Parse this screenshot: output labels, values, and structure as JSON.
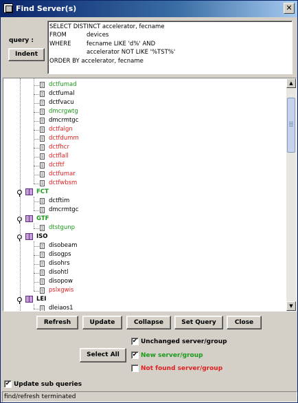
{
  "window": {
    "title": "Find Server(s)",
    "close_glyph": "✕"
  },
  "query": {
    "label": "query :",
    "indent_button": "Indent",
    "lines": [
      {
        "kw": "SELECT DISTINCT accelerator, fecname",
        "rest": ""
      },
      {
        "kw": "FROM",
        "rest": "devices"
      },
      {
        "kw": "WHERE",
        "rest": "fecname LIKE 'd%' AND"
      },
      {
        "kw": "",
        "rest": "accelerator NOT LIKE '%TST%'"
      },
      {
        "kw": "ORDER BY accelerator, fecname",
        "rest": ""
      }
    ]
  },
  "colors": {
    "unchanged": "#000000",
    "new": "#1a9a1a",
    "not_found": "#e02020",
    "group_folder": "#c8a0d8"
  },
  "tree": {
    "items": [
      {
        "kind": "leaf",
        "text": "dctfumad",
        "status": "new"
      },
      {
        "kind": "leaf",
        "text": "dctfumal",
        "status": "unchanged"
      },
      {
        "kind": "leaf",
        "text": "dctfvacu",
        "status": "unchanged"
      },
      {
        "kind": "leaf",
        "text": "dmcrgwtg",
        "status": "new"
      },
      {
        "kind": "leaf",
        "text": "dmcrmtgc",
        "status": "unchanged"
      },
      {
        "kind": "leaf",
        "text": "dctfalgn",
        "status": "not_found"
      },
      {
        "kind": "leaf",
        "text": "dctfdumm",
        "status": "not_found"
      },
      {
        "kind": "leaf",
        "text": "dctfhcr",
        "status": "not_found"
      },
      {
        "kind": "leaf",
        "text": "dctflall",
        "status": "not_found"
      },
      {
        "kind": "leaf",
        "text": "dctftf",
        "status": "not_found"
      },
      {
        "kind": "leaf",
        "text": "dctfumar",
        "status": "not_found"
      },
      {
        "kind": "leaf",
        "text": "dctfwbsm",
        "status": "not_found"
      },
      {
        "kind": "group",
        "text": "FCT",
        "status": "new"
      },
      {
        "kind": "leaf",
        "text": "dctftim",
        "status": "unchanged"
      },
      {
        "kind": "leaf",
        "text": "dmcrmtgc",
        "status": "unchanged"
      },
      {
        "kind": "group",
        "text": "GTF",
        "status": "new"
      },
      {
        "kind": "leaf",
        "text": "dtstgunp",
        "status": "new"
      },
      {
        "kind": "group",
        "text": "ISO",
        "status": "unchanged"
      },
      {
        "kind": "leaf",
        "text": "disobeam",
        "status": "unchanged"
      },
      {
        "kind": "leaf",
        "text": "disogps",
        "status": "unchanged"
      },
      {
        "kind": "leaf",
        "text": "disohrs",
        "status": "unchanged"
      },
      {
        "kind": "leaf",
        "text": "disohtl",
        "status": "unchanged"
      },
      {
        "kind": "leaf",
        "text": "disopow",
        "status": "unchanged"
      },
      {
        "kind": "leaf",
        "text": "pslxgwis",
        "status": "not_found"
      },
      {
        "kind": "group",
        "text": "LEI",
        "status": "unchanged"
      },
      {
        "kind": "leaf",
        "text": "dleiaos1",
        "status": "unchanged"
      }
    ],
    "scroll": {
      "up_arrow": "▲",
      "down_arrow": "▼"
    }
  },
  "actions": {
    "refresh": "Refresh",
    "update": "Update",
    "collapse": "Collapse",
    "set_query": "Set Query",
    "close": "Close",
    "select_all": "Select All"
  },
  "filters": [
    {
      "label": "Unchanged server/group",
      "checked": true,
      "status": "unchanged"
    },
    {
      "label": "New server/group",
      "checked": true,
      "status": "new"
    },
    {
      "label": "Not found server/group",
      "checked": false,
      "status": "not_found"
    }
  ],
  "update_sub_queries": {
    "label": "Update sub queries",
    "checked": true
  },
  "check_glyph": "✔",
  "status_text": "find/refresh terminated"
}
